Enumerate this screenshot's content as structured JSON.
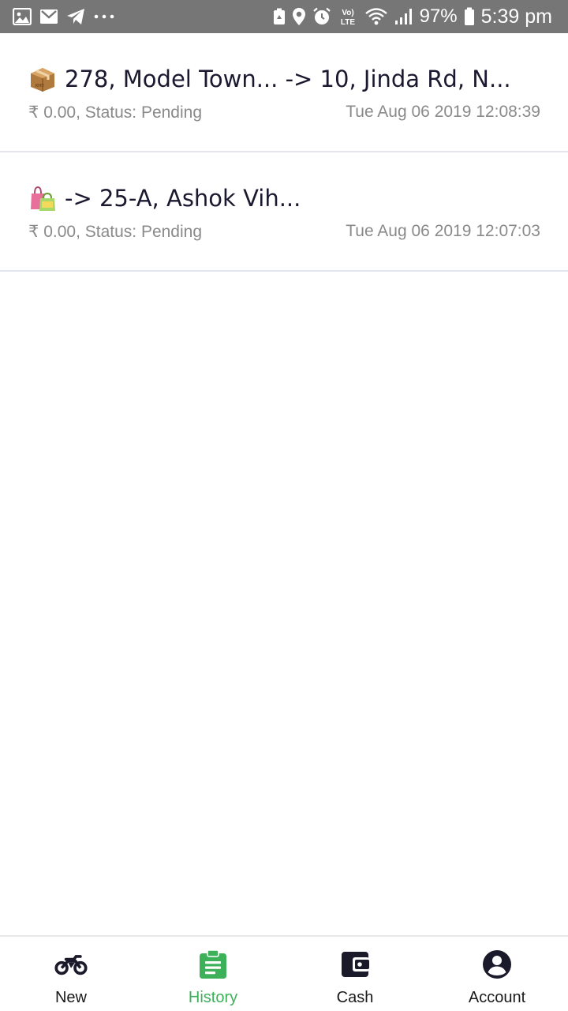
{
  "status_bar": {
    "left_icons": [
      "gallery-icon",
      "gmail-icon",
      "telegram-icon",
      "more-dots-icon"
    ],
    "right_icons": [
      "battery-saver-icon",
      "location-icon",
      "alarm-icon",
      "volte-icon",
      "wifi-icon",
      "signal-icon",
      "battery-icon"
    ],
    "volte_label": "Vo) LTE",
    "battery_percent": "97%",
    "time": "5:39 pm",
    "background_color": "#767676"
  },
  "orders": [
    {
      "emoji": "package-icon",
      "title": "278, Model Town... -> 10, Jinda Rd, N...",
      "meta": "₹ 0.00, Status: Pending",
      "timestamp": "Tue Aug 06 2019 12:08:39"
    },
    {
      "emoji": "shopping-bags-icon",
      "title": "-> 25-A, Ashok Vih...",
      "meta": "₹ 0.00, Status: Pending",
      "timestamp": "Tue Aug 06 2019 12:07:03"
    }
  ],
  "bottom_nav": {
    "active_color": "#3cb15a",
    "items": [
      {
        "label": "New",
        "icon": "motorbike-icon",
        "active": false
      },
      {
        "label": "History",
        "icon": "clipboard-icon",
        "active": true
      },
      {
        "label": "Cash",
        "icon": "wallet-icon",
        "active": false
      },
      {
        "label": "Account",
        "icon": "account-circle-icon",
        "active": false
      }
    ]
  }
}
